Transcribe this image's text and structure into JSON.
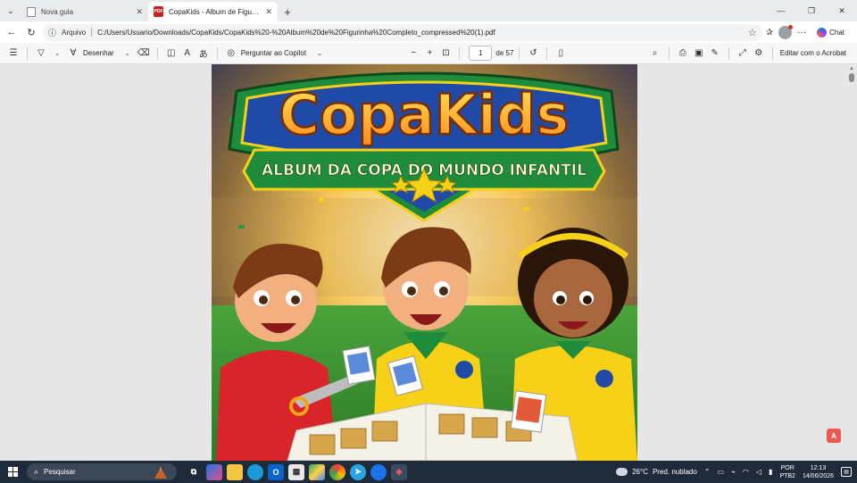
{
  "browser": {
    "tabs": [
      {
        "title": "Nova guia",
        "active": false
      },
      {
        "title": "CopaKids - Album de Figurinha Co",
        "active": true
      }
    ],
    "address": {
      "scheme_label": "Arquivo",
      "url": "C:/Users/Usuario/Downloads/CopaKids/CopaKids%20-%20Album%20de%20Figurinha%20Completo_compressed%20(1).pdf"
    },
    "chat_label": "Chat"
  },
  "pdf_toolbar": {
    "draw_label": "Desenhar",
    "copilot_label": "Perguntar ao Copilot",
    "page_current": "1",
    "page_total": "de 57",
    "edit_acrobat_label": "Editar com o Acrobat"
  },
  "document": {
    "title_text": "CopaKids",
    "banner_text": "ÁLBUM DA COPA DO MUNDO INFANTIL"
  },
  "taskbar": {
    "search_placeholder": "Pesquisar",
    "weather_temp": "26°C",
    "weather_desc": "Pred. nublado",
    "lang_top": "POR",
    "lang_bottom": "PTB2",
    "time": "12:13",
    "date": "14/06/2026"
  },
  "colors": {
    "pdf_red": "#c5221f",
    "brazil_yellow": "#f7d117",
    "brazil_green": "#1e8c3a",
    "banner_blue": "#1f4aa8",
    "taskbar_bg": "#1f2a3a"
  }
}
